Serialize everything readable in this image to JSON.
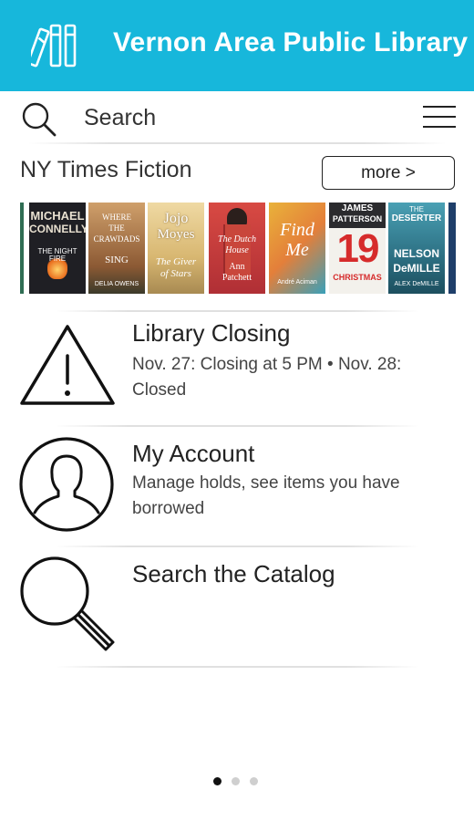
{
  "header": {
    "title": "Vernon Area Public Library",
    "background_color": "#17b7db",
    "logo_icon": "books-icon"
  },
  "search": {
    "placeholder": "Search",
    "search_icon": "search-icon",
    "menu_icon": "hamburger-menu-icon"
  },
  "carousel": {
    "title": "NY Times Fiction",
    "more_label": "more >",
    "books": [
      {
        "name": "book-partial-left",
        "lines": [],
        "bg": "#2f6d53"
      },
      {
        "name": "book-night-fire",
        "lines": [
          "MICHAEL",
          "CONNELLY",
          "THE NIGHT FIRE"
        ],
        "bg": "#1f1f24"
      },
      {
        "name": "book-crawdads",
        "lines": [
          "WHERE",
          "THE",
          "CRAWDADS",
          "SING",
          "DELIA OWENS"
        ],
        "bg": "#b47a4a"
      },
      {
        "name": "book-giver-of-stars",
        "lines": [
          "Jojo",
          "Moyes",
          "The Giver",
          "of Stars"
        ],
        "bg": "#e6c98a"
      },
      {
        "name": "book-dutch-house",
        "lines": [
          "The Dutch",
          "House",
          "Ann",
          "Patchett"
        ],
        "bg": "#c73b3b"
      },
      {
        "name": "book-find-me",
        "lines": [
          "Find",
          "Me",
          "André Aciman"
        ],
        "bg": "#e3ad3b"
      },
      {
        "name": "book-19-christmas",
        "lines": [
          "JAMES",
          "PATTERSON",
          "19",
          "CHRISTMAS"
        ],
        "bg": "#f1f1ee"
      },
      {
        "name": "book-the-deserter",
        "lines": [
          "THE",
          "DESERTER",
          "NELSON",
          "DeMILLE",
          "ALEX DeMILLE"
        ],
        "bg": "#2f7a8e"
      },
      {
        "name": "book-partial-right",
        "lines": [],
        "bg": "#1f3f6a"
      }
    ]
  },
  "features": [
    {
      "id": "library-closing",
      "title": "Library Closing",
      "description": "Nov. 27: Closing at 5 PM • Nov. 28: Closed",
      "icon": "warning-icon"
    },
    {
      "id": "my-account",
      "title": "My Account",
      "description": "Manage holds, see items you have borrowed",
      "icon": "user-icon"
    },
    {
      "id": "search-catalog",
      "title": "Search the Catalog",
      "description": "",
      "icon": "magnifier-icon"
    }
  ],
  "pager": {
    "count": 3,
    "active": 0
  }
}
